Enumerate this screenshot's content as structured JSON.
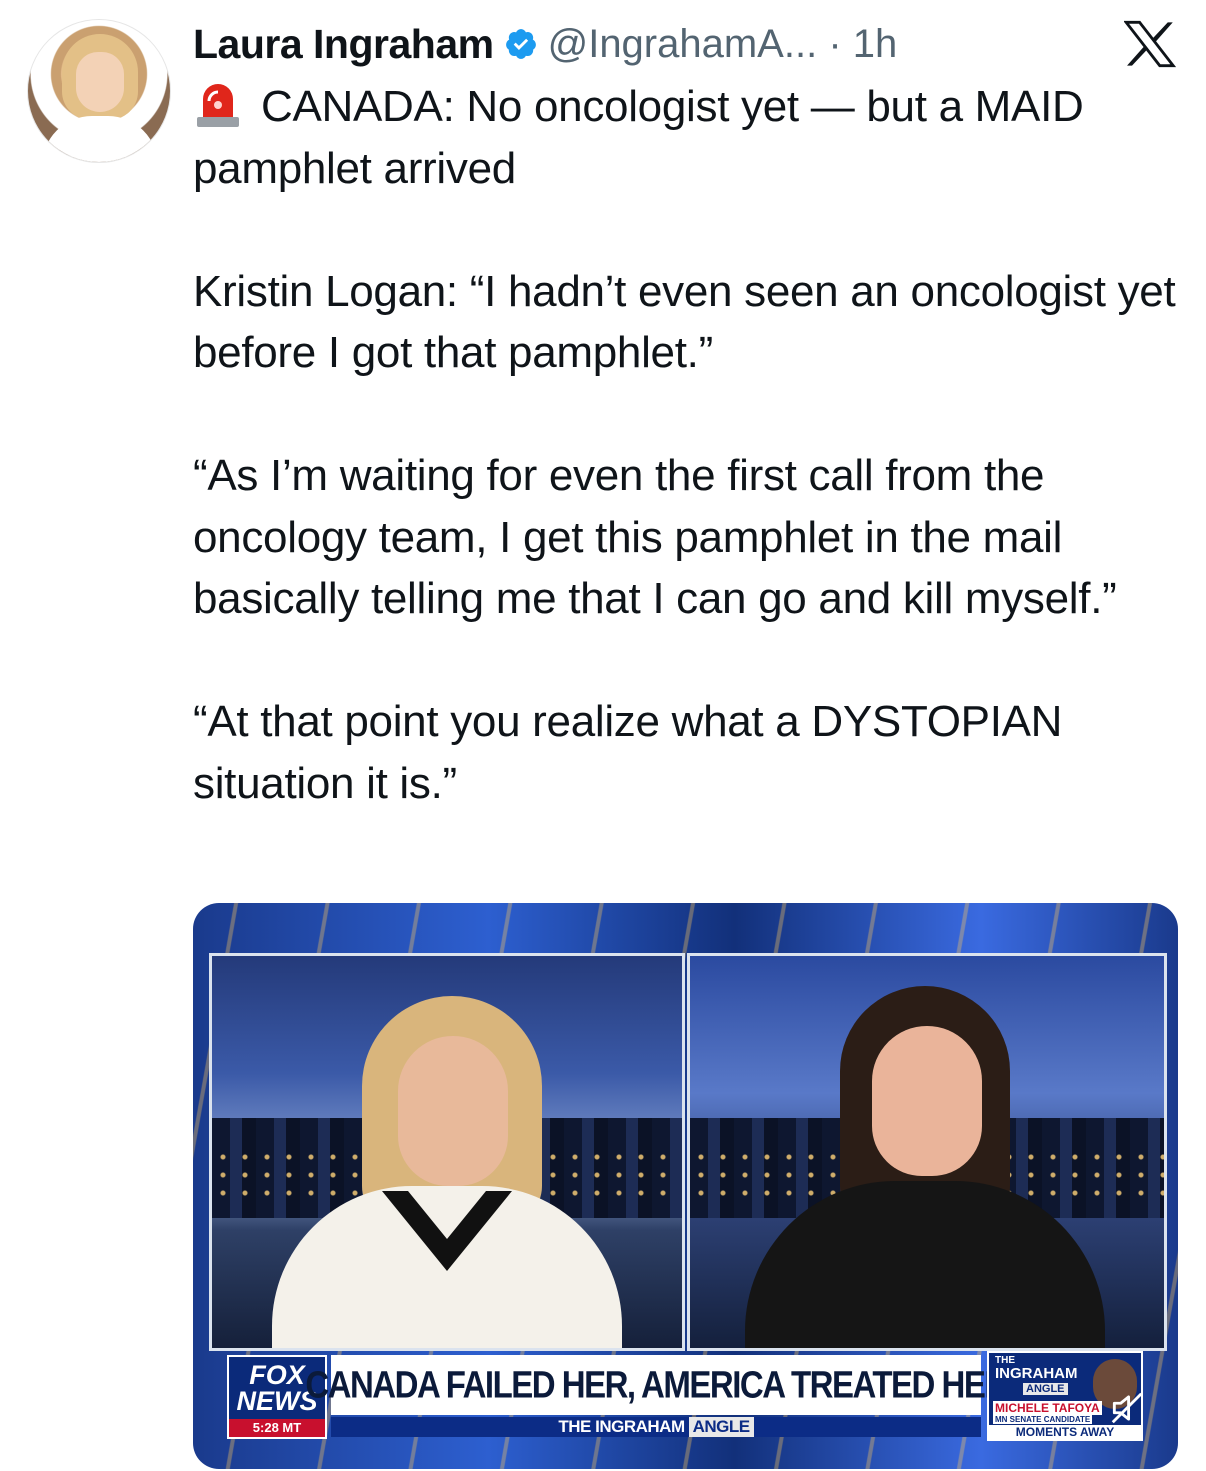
{
  "tweet": {
    "author_name": "Laura Ingraham",
    "handle_time": "@IngrahamA... · 1h",
    "paragraphs": [
      "CANADA: No oncologist yet — but a MAID pamphlet arrived",
      "Kristin Logan: “I hadn’t even seen an oncologist yet before I got that pamphlet.”",
      "“As I’m waiting for even the first call from the oncology team, I get this pamphlet in the mail basically telling me that I can go and kill myself.”",
      "“At that point you realize what a DYSTOPIAN situation it is.”"
    ],
    "lead_emoji": "siren-icon"
  },
  "media": {
    "network_logo_line1": "FOX",
    "network_logo_line2": "NEWS",
    "network_time": "5:28 MT",
    "headline": "CANADA FAILED HER, AMERICA TREATED HER",
    "show_prefix": "THE INGRAHAM",
    "show_suffix": "ANGLE",
    "promo": {
      "line1": "THE",
      "line2": "INGRAHAM",
      "line3": "ANGLE",
      "guest": "MICHELE TAFOYA",
      "guest_title": "MN SENATE CANDIDATE",
      "footer": "MOMENTS AWAY"
    }
  },
  "colors": {
    "verified_blue": "#1d9bf0",
    "handle_gray": "#536471",
    "text": "#0f1419"
  }
}
